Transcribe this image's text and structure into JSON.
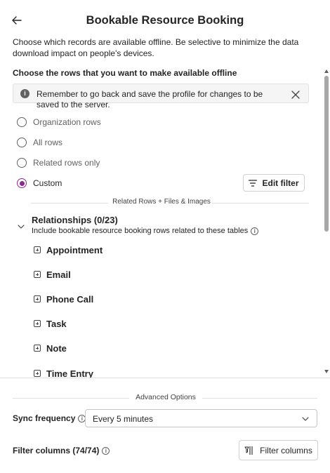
{
  "header": {
    "title": "Bookable Resource Booking"
  },
  "description": "Choose which records are available offline. Be selective to minimize the data download impact on people's devices.",
  "rows_section": {
    "heading": "Choose the rows that you want to make available offline",
    "banner_text": "Remember to go back and save the profile for changes to be saved to the server.",
    "options": [
      {
        "label": "Organization rows",
        "checked": false
      },
      {
        "label": "All rows",
        "checked": false
      },
      {
        "label": "Related rows only",
        "checked": false
      },
      {
        "label": "Custom",
        "checked": true
      }
    ],
    "edit_filter_label": "Edit filter"
  },
  "related_divider": "Related Rows + Files & Images",
  "relationships": {
    "title": "Relationships (0/23)",
    "subtitle": "Include bookable resource booking rows related to these tables",
    "tables": [
      "Appointment",
      "Email",
      "Phone Call",
      "Task",
      "Note",
      "Time Entry"
    ]
  },
  "advanced": {
    "divider": "Advanced Options",
    "sync_label": "Sync frequency",
    "sync_value": "Every 5 minutes",
    "filter_columns_label": "Filter columns (74/74)",
    "filter_columns_button": "Filter columns"
  },
  "colors": {
    "accent": "#8a2a8a",
    "text": "#242424"
  }
}
